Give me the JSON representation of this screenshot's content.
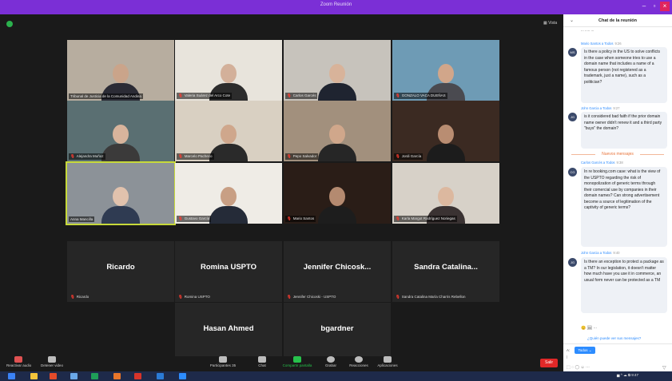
{
  "window": {
    "title": "Zoom Reunión"
  },
  "meeting": {
    "view_label": "Vista",
    "video_tiles": [
      {
        "name": "Tribunal de Justicia de la Comunidad Andina",
        "bg": "#b7ad9f",
        "skin": "#caa48a",
        "shirt": "#2b2b35",
        "muted": false
      },
      {
        "name": "Valeria Suárez del Arco Cote",
        "bg": "#e8e4dc",
        "skin": "#d3b09a",
        "shirt": "#2c2c2c",
        "muted": true
      },
      {
        "name": "Carlos Garcés",
        "bg": "#c7c3bc",
        "skin": "#d8b39a",
        "shirt": "#1f2430",
        "muted": true
      },
      {
        "name": "GONZALO VACA DUEÑAS",
        "bg": "#6e9bb5",
        "skin": "#d1a68a",
        "shirt": "#4a4a50",
        "muted": true
      },
      {
        "name": "Alejandra Muñoz",
        "bg": "#5a6f72",
        "skin": "#d8b49c",
        "shirt": "#3b3a3a",
        "muted": true
      },
      {
        "name": "Marcelo Pacheco",
        "bg": "#d9d0c2",
        "skin": "#cfa78c",
        "shirt": "#2a2a2a",
        "muted": true
      },
      {
        "name": "Pepo Salvador",
        "bg": "#a2907d",
        "skin": "#d0a78b",
        "shirt": "#262626",
        "muted": true
      },
      {
        "name": "Jordi García",
        "bg": "#3b2a22",
        "skin": "#b98d72",
        "shirt": "#1c1c1c",
        "muted": true
      },
      {
        "name": "Anna Mancilla",
        "bg": "#8c9298",
        "skin": "#e1c2ad",
        "shirt": "#2f3b52",
        "muted": false
      },
      {
        "name": "Gustavo García",
        "bg": "#efece6",
        "skin": "#c89f84",
        "shirt": "#252b38",
        "muted": true
      },
      {
        "name": "Mario Santos",
        "bg": "#2a1d17",
        "skin": "#b48a70",
        "shirt": "#1d1d1d",
        "muted": true
      },
      {
        "name": "Karla Margot Rodríguez Noriegas",
        "bg": "#d7d1c8",
        "skin": "#dcb89f",
        "shirt": "#3a3232",
        "muted": true
      }
    ],
    "name_tiles": [
      {
        "display": "Ricardo",
        "label": "Ricardo"
      },
      {
        "display": "Romina USPTO",
        "label": "Romina USPTO"
      },
      {
        "display": "Jennifer  Chicosk...",
        "label": "Jennifer Chicoski - USPTO"
      },
      {
        "display": "Sandra  Catalina...",
        "label": "Sandra Catalina María Charris Rebellon"
      },
      {
        "display": "Hasan Ahmed",
        "label": "Hasan Ahmed"
      },
      {
        "display": "bgardner",
        "label": "bgardner"
      }
    ]
  },
  "toolbar": {
    "audio": "Reactivar audio",
    "video": "Detener video",
    "participants": "Participantes",
    "participants_count": "35",
    "chat": "Chat",
    "share": "Compartir pantalla",
    "record": "Grabar",
    "reactions": "Reacciones",
    "apps": "Aplicaciones",
    "leave": "Salir"
  },
  "chat": {
    "title": "Chat de la reunión",
    "top_fragment": "... ..... ...",
    "messages": [
      {
        "from": "Mario Santos a Todos",
        "time": "9:26",
        "initials": "MS",
        "text": "Is there a policy in the US to solve conflicts in the case when someone tries to use a domain name that includes a name of a famous person (not registered as a trademark, just a name), such as a politician?"
      },
      {
        "from": "John Garcia a Todos",
        "time": "9:27",
        "initials": "JG",
        "text": "is it considered bad faith if the prior domain name owner didn't renew it and a third party \"buys\" the domain?"
      },
      {
        "from": "Carlos Garcés a Todos",
        "time": "9:38",
        "initials": "CG",
        "text": "In re booking.com case: what is the view of the USPTO regarding the risk of monopolization of generic terms through their comercial use by companies in their domain names? Can strong advertisement become a source of legitimation of the captivity of generic terms?"
      },
      {
        "from": "John Garcia a Todos",
        "time": "9:40",
        "initials": "JG",
        "text": "Is there an exception to protect a package as a TM? In our legislation, it doesn't matter how much have you use it in commerce, an usual form never can be protected as a TM"
      }
    ],
    "new_messages": "Nuevos mensajes",
    "reactions": "😊  🖼 ···",
    "reply_prompt": "¿Quién puede ver sus mensajes?",
    "to_label": "A:",
    "to_value": "Todos ⌄",
    "input_placeholder": "I",
    "format_icons": "⬚ ◌ ◯ ☺ ···",
    "send_icon": "▽"
  },
  "taskbar": {
    "apps": [
      {
        "color": "#3b82f6"
      },
      {
        "color": "#f3c33b"
      },
      {
        "color": "#e34b2a"
      },
      {
        "color": "#6aa7e8"
      },
      {
        "color": "#1f9e58"
      },
      {
        "color": "#e8762a"
      },
      {
        "color": "#d6342a"
      },
      {
        "color": "#2b7bd6"
      },
      {
        "color": "#2d8cff"
      }
    ],
    "tray": "▅ ^ ☁ ⧉  9:47"
  }
}
